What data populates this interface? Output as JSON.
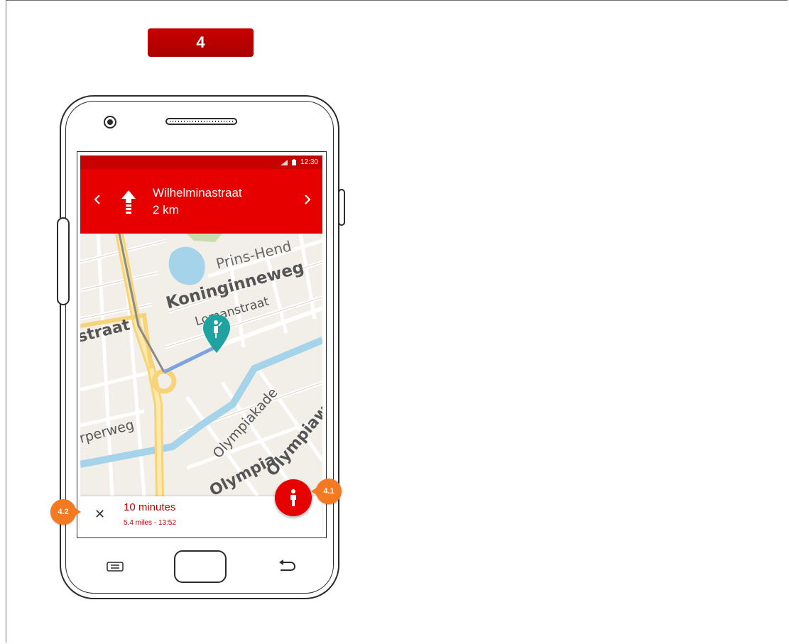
{
  "step_badge": "4",
  "status_bar": {
    "time": "12:30"
  },
  "navigation": {
    "street": "Wilhelminastraat",
    "distance": "2 km"
  },
  "map": {
    "labels": [
      "Prins-Hend",
      "Koninginneweg",
      "Lomanstraat",
      "straat",
      "rperweg",
      "Olympiakade",
      "Olympiaweg",
      "Olympia"
    ]
  },
  "route_summary": {
    "duration": "10 minutes",
    "meta": "5.4 miles - 13:52"
  },
  "callouts": {
    "walk_mode": "4.1",
    "close": "4.2"
  },
  "colors": {
    "brand_red": "#e60000",
    "callout_orange": "#f47920",
    "pin_teal": "#1fa3a0"
  }
}
